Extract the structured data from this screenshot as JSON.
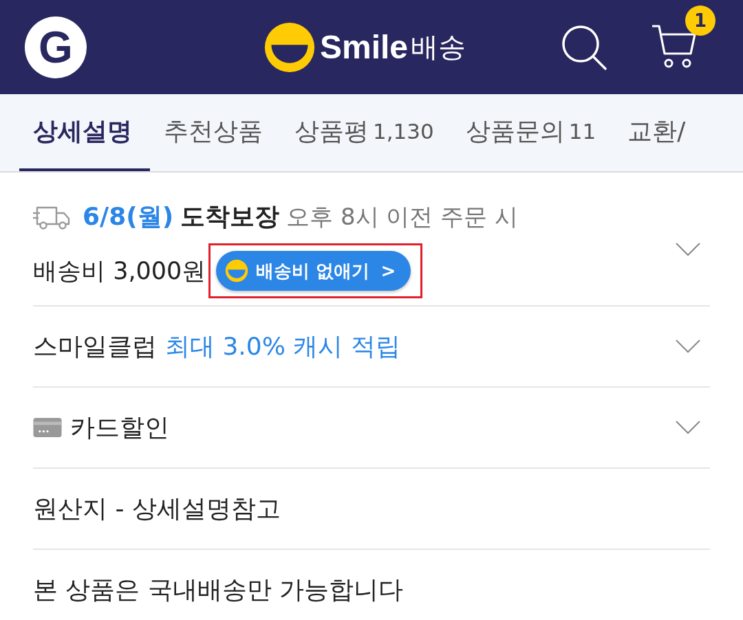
{
  "header": {
    "logo_letter": "G",
    "brand": "Smile",
    "brand_suffix": "배송",
    "cart_count": "1"
  },
  "tabs": [
    {
      "label": "상세설명",
      "selected": true
    },
    {
      "label": "추천상품",
      "selected": false
    },
    {
      "label": "상품평",
      "count": "1,130",
      "selected": false
    },
    {
      "label": "상품문의",
      "count": "11",
      "selected": false
    },
    {
      "label": "교환/",
      "selected": false
    }
  ],
  "delivery": {
    "date": "6/8(월)",
    "guarantee": "도착보장",
    "note": "오후 8시 이전 주문 시",
    "fee": "배송비 3,000원",
    "button": "배송비 없애기",
    "button_arrow": ">",
    "expanded": false
  },
  "rows": [
    {
      "kind": "club",
      "label": "스마일클럽",
      "highlight": "최대 3.0% 캐시 적립",
      "expanded": false
    },
    {
      "kind": "card",
      "label": "카드할인",
      "expanded": false
    },
    {
      "kind": "plain",
      "label": "원산지 - 상세설명참고"
    },
    {
      "kind": "plain",
      "label": "본 상품은 국내배송만 가능합니다"
    }
  ]
}
